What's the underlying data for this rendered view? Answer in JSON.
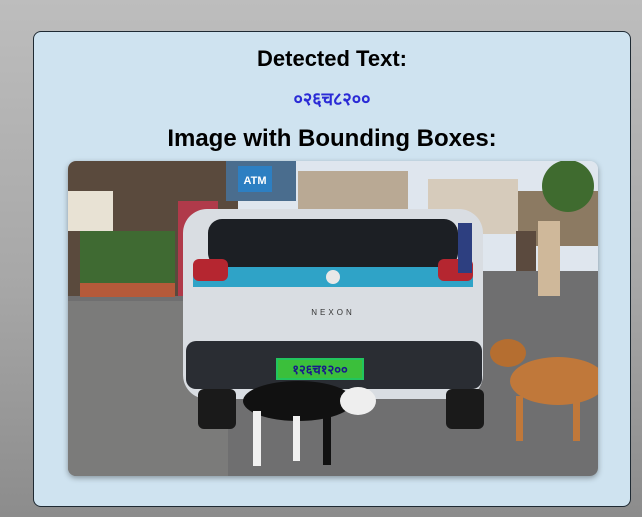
{
  "detected_text": {
    "heading": "Detected Text:",
    "value": "०२६च८२००"
  },
  "image_section": {
    "heading": "Image with Bounding Boxes:",
    "plate_label": "१२६च१२००",
    "shop_sign": "ATM",
    "car_badge": "NEXON",
    "box_color": "#22c55e"
  },
  "colors": {
    "card_bg": "#cfe3f0",
    "detected_value": "#2b2bd6"
  }
}
